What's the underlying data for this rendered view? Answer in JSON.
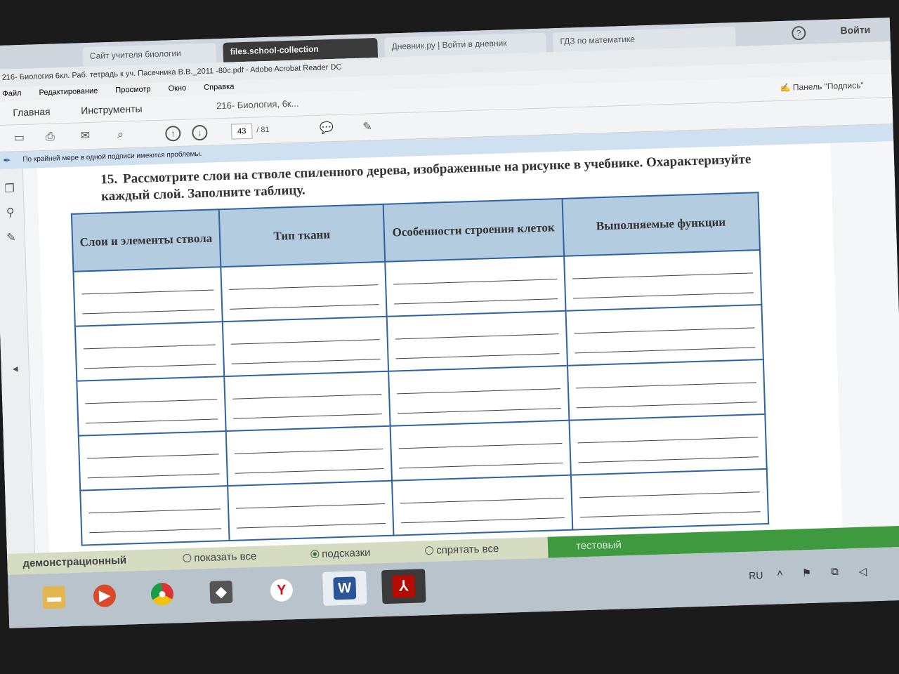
{
  "browser_tabs": [
    {
      "label": "Сайт учителя биологии",
      "active": false
    },
    {
      "label": "files.school-collection",
      "active": true
    },
    {
      "label": "Дневник.ру | Войти в дневник",
      "active": false
    },
    {
      "label": "ГДЗ по математике",
      "active": false
    }
  ],
  "browser": {
    "login_label": "Войти",
    "help_glyph": "?"
  },
  "acrobat": {
    "title": "216- Биология 6кл. Раб. тетрадь к уч. Пасечника В.В._2011 -80с.pdf - Adobe Acrobat Reader DC",
    "menu": [
      "Файл",
      "Редактирование",
      "Просмотр",
      "Окно",
      "Справка"
    ],
    "nav_tabs": {
      "home": "Главная",
      "tools": "Инструменты",
      "doc": "216- Биология, 6к..."
    },
    "sign_label": "Панель \"Подпись\"",
    "page_current": "43",
    "page_total": "/ 81",
    "warning": "По крайней мере в одной подписи имеются проблемы."
  },
  "toolbar_icons": [
    "save-icon",
    "print-icon",
    "email-icon",
    "search-icon",
    "page-up-icon",
    "page-down-icon",
    "comment-icon",
    "pen-icon"
  ],
  "task": {
    "number": "15.",
    "text": "Рассмотрите слои на стволе спиленного дерева, изображенные на рисунке в учебнике. Охарактеризуйте каждый слой. Заполните таблицу."
  },
  "table": {
    "headers": [
      "Слои и элементы ствола",
      "Тип ткани",
      "Особенности строения клеток",
      "Выполняемые функции"
    ],
    "rows": 5
  },
  "demo_bar": {
    "mode": "демонстрационный",
    "show_all": "показать все",
    "hints": "подсказки",
    "hide_all": "спрятать все",
    "test_mode": "тестовый"
  },
  "taskbar": {
    "apps": [
      "Проводник",
      "Медиаплеер",
      "Chrome",
      "Защитник",
      "Яндекс",
      "Word",
      "Adobe Acrobat"
    ],
    "lang": "RU"
  }
}
